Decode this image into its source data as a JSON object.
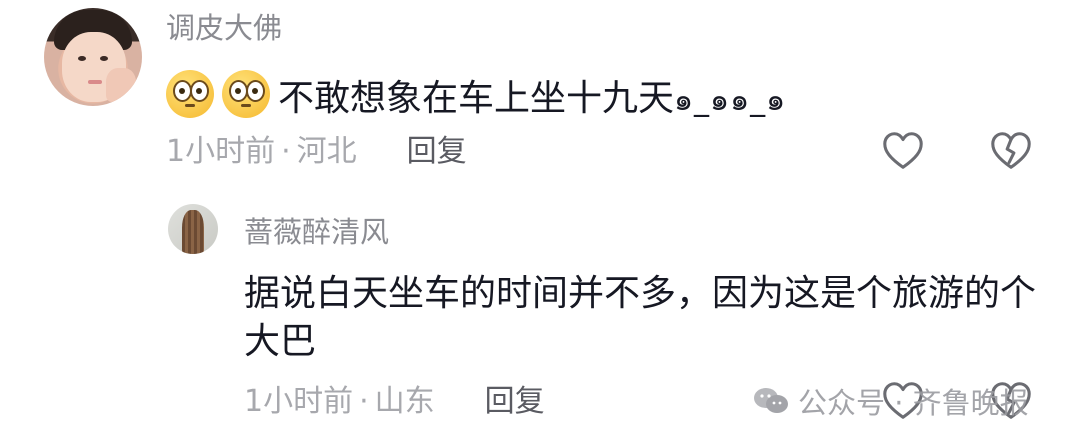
{
  "comment": {
    "username": "调皮大佛",
    "emojis": [
      "flushed-face-emoji",
      "flushed-face-emoji"
    ],
    "text": "不敢想象在车上坐十九天",
    "kaomoji": "๑_๑๑_๑",
    "time": "1小时前",
    "separator": "·",
    "location": "河北",
    "reply_label": "回复"
  },
  "reply": {
    "username": "蔷薇醉清风",
    "text": "据说白天坐车的时间并不多，因为这是个旅游的个大巴",
    "time": "1小时前",
    "separator": "·",
    "location": "山东",
    "reply_label": "回复"
  },
  "watermark": {
    "text": "公众号 · 齐鲁晚报",
    "icon": "wechat-icon"
  },
  "icons": {
    "like": "heart-outline-icon",
    "dislike": "broken-heart-icon"
  },
  "colors": {
    "text_primary": "#161823",
    "text_secondary": "#8a8b91",
    "meta": "#a7a8ad"
  }
}
